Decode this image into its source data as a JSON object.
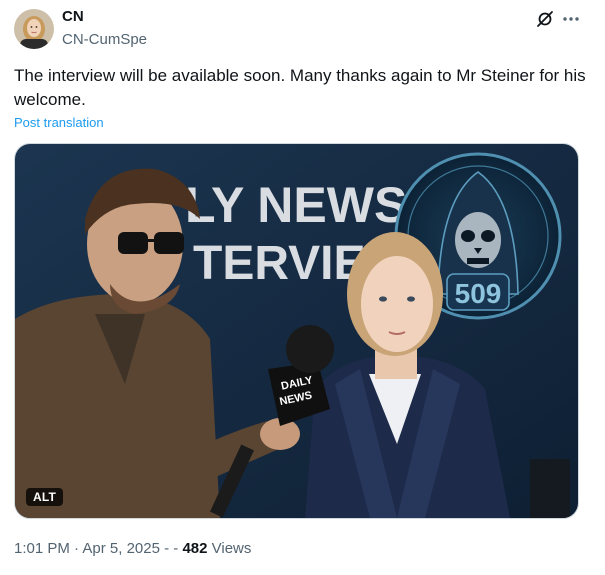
{
  "author": {
    "display_name": "CN",
    "handle": "CN-CumSpe",
    "avatar_icon": "avatar-photo"
  },
  "header_actions": {
    "grok_icon": "grok-icon",
    "more_icon": "more-icon"
  },
  "tweet": {
    "text": "The interview will be available soon. Many thanks again to Mr Steiner for his welcome.",
    "translate_label": "Post translation"
  },
  "media": {
    "alt_label": "ALT",
    "banner_line1": "LY NEWS",
    "banner_line2": "TERVIEW",
    "logo_number": "509",
    "mic_text_line1": "DAILY",
    "mic_text_line2": "NEWS",
    "mic_side_text": "DAILY NEWS"
  },
  "meta": {
    "time": "1:01 PM",
    "separator1": " · ",
    "date": "Apr 5, 2025",
    "separator2": " - - ",
    "views_count": "482",
    "views_label": " Views"
  },
  "colors": {
    "accent": "#1d9bf0",
    "text_primary": "#0f1419",
    "text_secondary": "#536471"
  }
}
